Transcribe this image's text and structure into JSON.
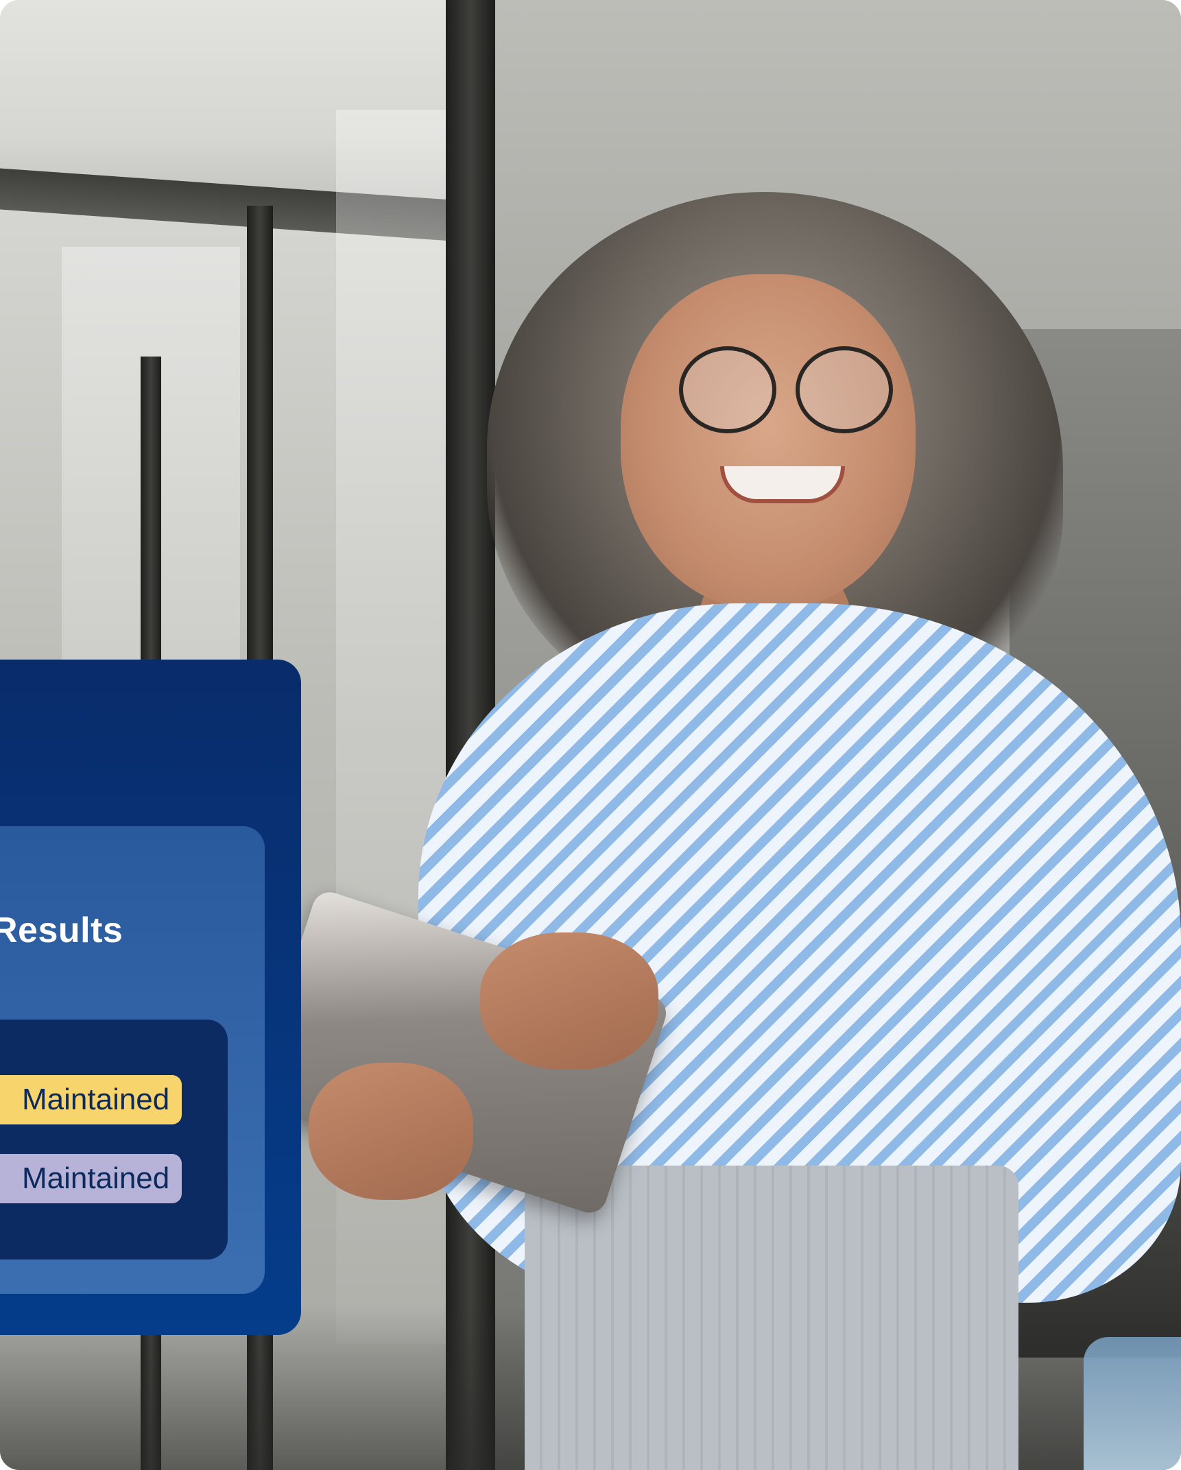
{
  "results_card": {
    "title": "Results",
    "statuses": [
      {
        "label": "Maintained",
        "color": "#f8d46d"
      },
      {
        "label": "Maintained",
        "color": "#b7b2d8"
      }
    ],
    "colors": {
      "outer": "#053d8b",
      "mid": "#3b6fb1",
      "inner": "#0c2b63",
      "text": "#ffffff"
    }
  },
  "photo": {
    "subject": "smiling-woman-with-tablet"
  }
}
